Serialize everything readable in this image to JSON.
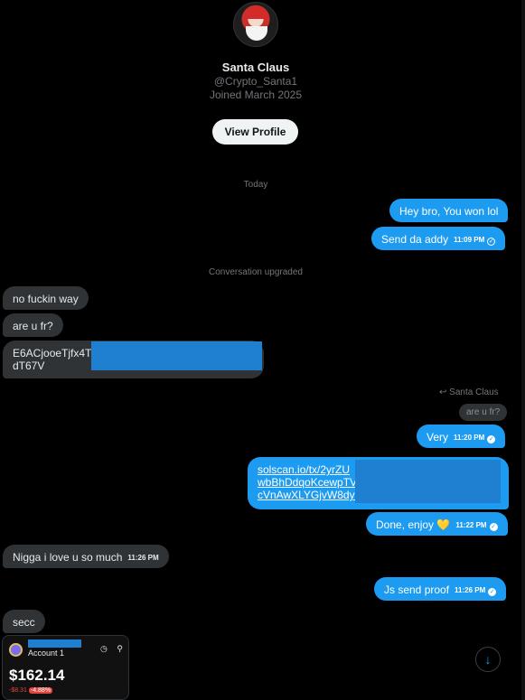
{
  "profile": {
    "name": "Santa Claus",
    "handle": "@Crypto_Santa1",
    "joined": "Joined March 2025",
    "view_profile_label": "View Profile"
  },
  "dividers": {
    "today": "Today",
    "upgraded": "Conversation upgraded"
  },
  "messages": {
    "m1": "Hey bro, You won lol",
    "m2": "Send da addy",
    "m2_time": "11:09 PM",
    "m3": "no fuckin way",
    "m4": "are u fr?",
    "m5_line1": "E6ACjooeTjfx4T",
    "m5_line2": "dT67V",
    "reply_to": "Santa Claus",
    "quoted": "are u fr?",
    "m6": "Very",
    "m6_time": "11:20 PM",
    "m7_line1": "solscan.io/tx/2yrZU",
    "m7_line2": "wbBhDdqoKcewpTV",
    "m7_line3": "cVnAwXLYGjvW8dys",
    "m8": "Done, enjoy 💛",
    "m8_time": "11:22 PM",
    "m9": "Nigga i love u so much",
    "m9_time": "11:26 PM",
    "m10": "Js send proof",
    "m10_time": "11:26 PM",
    "m11": "secc"
  },
  "wallet": {
    "account": "Account 1",
    "balance": "$162.14",
    "change": "-$8.31",
    "pct": "-4.88%"
  },
  "icons": {
    "scroll": "arrow-down-icon",
    "reply": "reply-arrow-icon",
    "timer": "clock-icon",
    "search": "search-icon"
  },
  "colors": {
    "accent": "#1d9bf0",
    "incoming": "#2f3336",
    "background": "#000000"
  }
}
